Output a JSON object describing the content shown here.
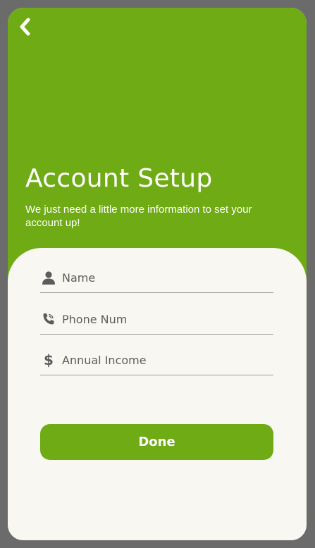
{
  "header": {
    "title": "Account Setup",
    "subtitle": "We just need a little more information to set your account up!"
  },
  "form": {
    "fields": [
      {
        "placeholder": "Name",
        "value": "",
        "icon": "person-icon"
      },
      {
        "placeholder": "Phone Num",
        "value": "",
        "icon": "phone-icon"
      },
      {
        "placeholder": "Annual Income",
        "value": "",
        "icon": "dollar-icon"
      }
    ],
    "dollar_glyph": "$",
    "submit_label": "Done"
  },
  "colors": {
    "accent": "#6fab15",
    "card_background": "#f8f7f2",
    "frame": "#6b6b6b"
  }
}
